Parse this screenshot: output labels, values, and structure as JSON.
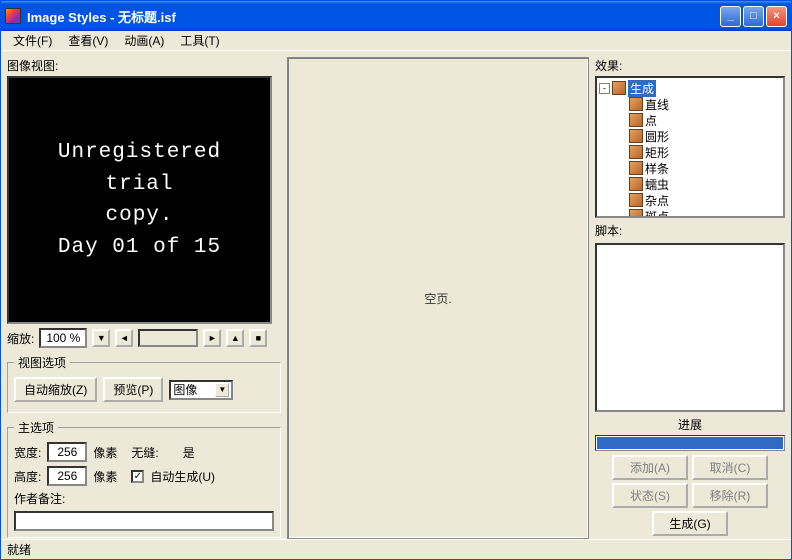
{
  "window": {
    "title": "Image Styles - 无标题.isf"
  },
  "menu": {
    "file": "文件(F)",
    "view": "查看(V)",
    "anim": "动画(A)",
    "tools": "工具(T)"
  },
  "left": {
    "image_view_label": "图像视图:",
    "preview_text": "Unregistered\ntrial\ncopy.\nDay 01 of 15",
    "zoom_label": "缩放:",
    "zoom_value": "100 %",
    "view_options_legend": "视图选项",
    "auto_zoom_btn": "自动缩放(Z)",
    "preview_btn": "预览(P)",
    "image_combo": "图像",
    "main_options_legend": "主选项",
    "width_label": "宽度:",
    "width_value": "256",
    "height_label": "高度:",
    "height_value": "256",
    "pixels": "像素",
    "seamless_label": "无缝:",
    "seamless_value": "是",
    "autogen_label": "自动生成(U)",
    "autogen_checked": true,
    "author_label": "作者备注:",
    "author_value": ""
  },
  "mid": {
    "empty_text": "空页."
  },
  "right": {
    "effects_label": "效果:",
    "tree_root": "生成",
    "tree_items": [
      "直线",
      "点",
      "圆形",
      "矩形",
      "样条",
      "蠕虫",
      "杂点",
      "斑点"
    ],
    "script_label": "脚本:",
    "progress_label": "进展",
    "btn_add": "添加(A)",
    "btn_cancel": "取消(C)",
    "btn_status": "状态(S)",
    "btn_remove": "移除(R)",
    "btn_generate": "生成(G)"
  },
  "status": {
    "text": "就绪"
  }
}
